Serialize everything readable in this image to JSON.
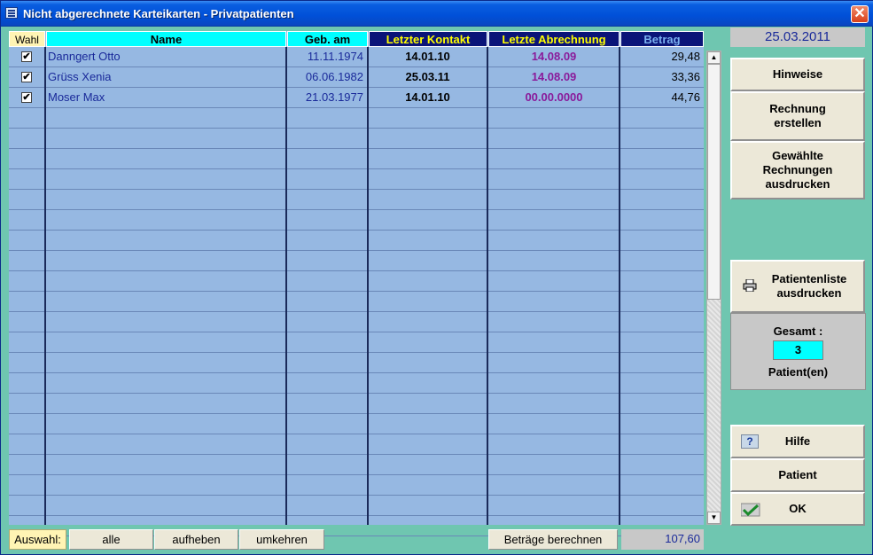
{
  "window": {
    "title": "Nicht abgerechnete Karteikarten - Privatpatienten",
    "close_label": "✕"
  },
  "table": {
    "headers": {
      "wahl": "Wahl",
      "name": "Name",
      "geb": "Geb. am",
      "kontakt": "Letzter Kontakt",
      "abrechnung": "Letzte Abrechnung",
      "betrag": "Betrag"
    },
    "rows": [
      {
        "checked": "✔",
        "name": "Danngert Otto",
        "geb": "11.11.1974",
        "kontakt": "14.01.10",
        "abrechnung": "14.08.09",
        "betrag": "29,48"
      },
      {
        "checked": "✔",
        "name": "Grüss Xenia",
        "geb": "06.06.1982",
        "kontakt": "25.03.11",
        "abrechnung": "14.08.09",
        "betrag": "33,36"
      },
      {
        "checked": "✔",
        "name": "Moser Max",
        "geb": "21.03.1977",
        "kontakt": "14.01.10",
        "abrechnung": "00.00.0000",
        "betrag": "44,76"
      }
    ]
  },
  "scrollbar": {
    "up": "▲",
    "down": "▼"
  },
  "side": {
    "date": "25.03.2011",
    "hinweise": "Hinweise",
    "rechnung_1": "Rechnung",
    "rechnung_2": "erstellen",
    "gewaehlte_1": "Gewählte",
    "gewaehlte_2": "Rechnungen",
    "gewaehlte_3": "ausdrucken",
    "patientenliste_1": "Patientenliste",
    "patientenliste_2": "ausdrucken",
    "gesamt_label": "Gesamt :",
    "gesamt_value": "3",
    "gesamt_unit": "Patient(en)",
    "hilfe": "Hilfe",
    "help_icon_glyph": "?",
    "patient": "Patient",
    "ok": "OK"
  },
  "bottom": {
    "auswahl": "Auswahl:",
    "alle": "alle",
    "aufheben": "aufheben",
    "umkehren": "umkehren",
    "berechnen": "Beträge berechnen",
    "total": "107,60"
  },
  "colors": {
    "background": "#6fc6b0",
    "grid": "#96b8e2",
    "header_dark": "#0a1478",
    "header_light": "#00ffff"
  }
}
